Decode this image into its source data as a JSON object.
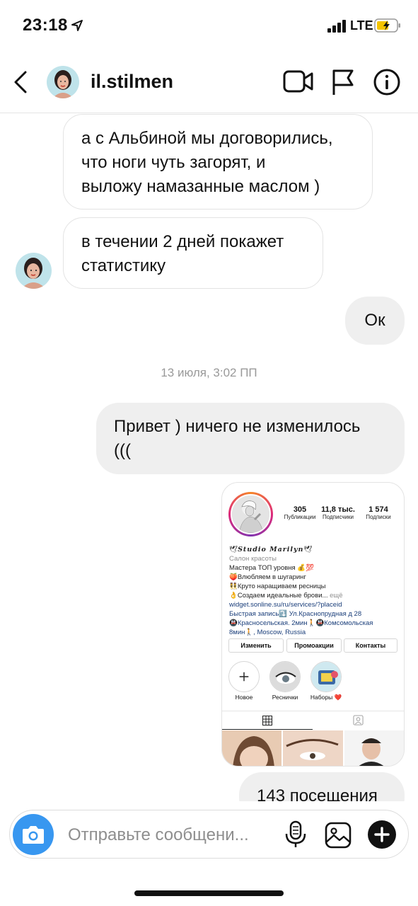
{
  "status_bar": {
    "time": "23:18",
    "network": "LTE",
    "icons": [
      "location-arrow-icon",
      "signal-bars-icon",
      "battery-charging-icon"
    ]
  },
  "header": {
    "username": "il.stilmen",
    "icons": [
      "back-chevron-icon",
      "video-camera-icon",
      "flag-icon",
      "info-icon"
    ]
  },
  "messages": [
    {
      "side": "incoming",
      "lines": [
        "а с Альбиной мы договорились,",
        "что ноги чуть загорят, и",
        "выложу намазанные маслом )"
      ]
    },
    {
      "side": "incoming",
      "lines": [
        "в течении 2 дней покажет",
        "статистику"
      ]
    },
    {
      "side": "outgoing",
      "lines": [
        "Ок"
      ]
    },
    {
      "side": "outgoing",
      "lines": [
        "Привет ) ничего не изменилось",
        "((("
      ]
    },
    {
      "side": "outgoing",
      "lines": [
        "143 посещения"
      ]
    }
  ],
  "timestamp": "13 июля, 3:02 ПП",
  "shared_profile": {
    "stats": [
      {
        "value": "305",
        "label": "Публикации"
      },
      {
        "value": "11,8 тыс.",
        "label": "Подписчики"
      },
      {
        "value": "1 574",
        "label": "Подписки"
      }
    ],
    "bio_name": "Studio Marilyn",
    "bio_category": "Салон красоты",
    "bio_lines": [
      "Мастера ТОП уровня 💰💯",
      "🍑Влюбляем в шугаринг",
      "👯Круто наращиваем ресницы",
      "👌Создаем идеальные брови..."
    ],
    "bio_more": "ещё",
    "bio_link": "widget.sonline.su/ru/services/?placeid",
    "bio_address_lines": [
      "Быстрая запись⤵️  Ул.Краснопрудная д 28",
      "🚇Красносельская. 2мин🚶🚇Комсомольская",
      "8мин🚶, Moscow, Russia"
    ],
    "buttons": [
      "Изменить",
      "Промоакции",
      "Контакты"
    ],
    "highlights": [
      "Новое",
      "Реснички",
      "Наборы ❤️"
    ]
  },
  "composer": {
    "placeholder": "Отправьте сообщени...",
    "icons": [
      "camera-icon",
      "microphone-icon",
      "gallery-icon",
      "plus-icon"
    ]
  },
  "colors": {
    "accent": "#3897f0",
    "bubble_out": "#efefef",
    "bubble_in_border": "#e3e3e3",
    "timestamp": "#999999"
  }
}
